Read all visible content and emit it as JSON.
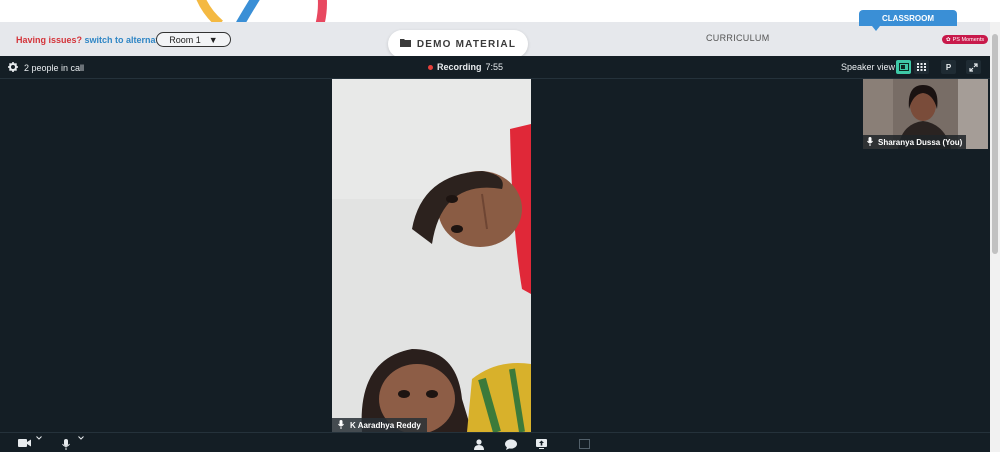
{
  "header": {
    "issues_question": "Having issues?",
    "issues_link": "switch to alternate room",
    "room_value": "Room 1",
    "demo_material_label": "DEMO MATERIAL",
    "curriculum_label": "CURRICULUM",
    "classroom_label": "CLASSROOM",
    "moments_label": "PS Moments"
  },
  "call": {
    "people_count": "2 people in call",
    "recording_label": "Recording",
    "recording_time": "7:55",
    "speaker_view_label": "Speaker view",
    "participant_button_label": "P"
  },
  "participants": {
    "main": {
      "name": "K Aaradhya Reddy"
    },
    "self": {
      "name": "Sharanya Dussa (You)"
    }
  },
  "colors": {
    "call_background": "#141e25",
    "header_background": "#e6e8ec",
    "accent_green": "#3ec9a7",
    "classroom_blue": "#3a8fd6",
    "recording_red": "#e6403b",
    "issues_red": "#d4343a",
    "link_blue": "#2f86c5"
  },
  "icons": {
    "settings": "gear-icon",
    "folder": "folder-icon",
    "speaker_layout": "speaker-layout-icon",
    "grid_layout": "grid-icon",
    "fullscreen": "fullscreen-icon",
    "mic": "microphone-icon",
    "camera": "camera-icon",
    "people": "people-icon",
    "chat": "chat-icon",
    "share": "share-screen-icon"
  }
}
